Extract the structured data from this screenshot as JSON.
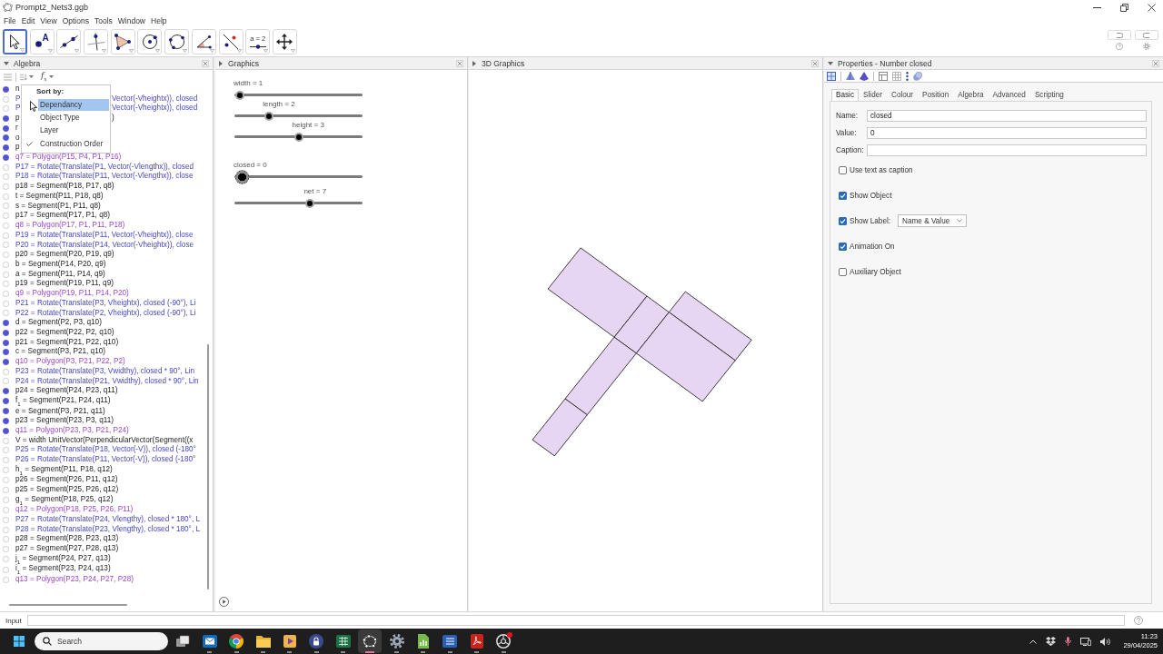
{
  "window": {
    "title": "Prompt2_Nets3.ggb"
  },
  "menu": [
    "File",
    "Edit",
    "View",
    "Options",
    "Tools",
    "Window",
    "Help"
  ],
  "toolbar": {
    "tools": [
      {
        "kind": "move",
        "selected": true
      },
      {
        "kind": "point",
        "text": "A",
        "selected": false
      },
      {
        "kind": "line",
        "selected": false
      },
      {
        "kind": "perpendicular",
        "selected": false
      },
      {
        "kind": "polygon",
        "selected": false
      },
      {
        "kind": "circle",
        "selected": false
      },
      {
        "kind": "conic",
        "selected": false
      },
      {
        "kind": "angle",
        "selected": false
      },
      {
        "kind": "reflect",
        "selected": false
      },
      {
        "kind": "slider",
        "text": "a = 2",
        "selected": false
      },
      {
        "kind": "pan",
        "selected": false
      }
    ]
  },
  "algebra": {
    "title": "Algebra",
    "style_button": "f$_{x}$",
    "sort_menu": {
      "title": "Sort by:",
      "items": [
        {
          "label": "Dependancy",
          "selected": true,
          "checked": false
        },
        {
          "label": "Object Type",
          "selected": false,
          "checked": false
        },
        {
          "label": "Layer",
          "selected": false,
          "checked": false
        },
        {
          "label": "Construction Order",
          "selected": false,
          "checked": true
        }
      ]
    },
    "rows": [
      {
        "text": "n",
        "kind": "other",
        "visible": true
      },
      {
        "text": "P",
        "tail": "Vector(-Vheightx)), closed",
        "kind": "point",
        "visible": false
      },
      {
        "text": "P",
        "tail": "Vector(-Vheightx)), closed",
        "kind": "point",
        "visible": false
      },
      {
        "text": "p",
        "tail": ")",
        "kind": "other",
        "visible": true
      },
      {
        "text": "r",
        "kind": "other",
        "visible": true
      },
      {
        "text": "o",
        "kind": "other",
        "visible": true
      },
      {
        "text": "p",
        "kind": "other",
        "visible": true
      },
      {
        "text": "q7 = Polygon(P15, P4, P1, P16)",
        "kind": "polygon",
        "visible": true
      },
      {
        "text": "P17 = Rotate(Translate(P1, Vector(-Vlengthx)), closed",
        "kind": "point",
        "visible": false
      },
      {
        "text": "P18 = Rotate(Translate(P11, Vector(-Vlengthx)), close",
        "kind": "point",
        "visible": false
      },
      {
        "text": "p18 = Segment(P18, P17, q8)",
        "kind": "other",
        "visible": false
      },
      {
        "text": "t = Segment(P11, P18, q8)",
        "kind": "other",
        "visible": false
      },
      {
        "text": "s = Segment(P1, P11, q8)",
        "kind": "other",
        "visible": false
      },
      {
        "text": "p17 = Segment(P17, P1, q8)",
        "kind": "other",
        "visible": false
      },
      {
        "text": "q8 = Polygon(P17, P1, P11, P18)",
        "kind": "polygon",
        "visible": false
      },
      {
        "text": "P19 = Rotate(Translate(P11, Vector(-Vheightx)), close",
        "kind": "point",
        "visible": false
      },
      {
        "text": "P20 = Rotate(Translate(P14, Vector(-Vheightx)), close",
        "kind": "point",
        "visible": false
      },
      {
        "text": "p20 = Segment(P20, P19, q9)",
        "kind": "other",
        "visible": false
      },
      {
        "text": "b = Segment(P14, P20, q9)",
        "kind": "other",
        "visible": false
      },
      {
        "text": "a = Segment(P11, P14, q9)",
        "kind": "other",
        "visible": false
      },
      {
        "text": "p19 = Segment(P19, P11, q9)",
        "kind": "other",
        "visible": false
      },
      {
        "text": "q9 = Polygon(P19, P11, P14, P20)",
        "kind": "polygon",
        "visible": false
      },
      {
        "text": "P21 = Rotate(Translate(P3, Vheightx), closed (-90°), Li",
        "kind": "point",
        "visible": false
      },
      {
        "text": "P22 = Rotate(Translate(P2, Vheightx), closed (-90°), Li",
        "kind": "point",
        "visible": false
      },
      {
        "text": "d = Segment(P2, P3, q10)",
        "kind": "other",
        "visible": true
      },
      {
        "text": "p22 = Segment(P22, P2, q10)",
        "kind": "other",
        "visible": true
      },
      {
        "text": "p21 = Segment(P21, P22, q10)",
        "kind": "other",
        "visible": true
      },
      {
        "text": "c = Segment(P3, P21, q10)",
        "kind": "other",
        "visible": true
      },
      {
        "text": "q10 = Polygon(P3, P21, P22, P2)",
        "kind": "polygon",
        "visible": true
      },
      {
        "text": "P23 = Rotate(Translate(P3, Vwidthy), closed * 90°, Lin",
        "kind": "point",
        "visible": false
      },
      {
        "text": "P24 = Rotate(Translate(P21, Vwidthy), closed * 90°, Lin",
        "kind": "point",
        "visible": false
      },
      {
        "text": "p24 = Segment(P24, P23, q11)",
        "kind": "other",
        "visible": true
      },
      {
        "text": "f$_{1}$ = Segment(P21, P24, q11)",
        "kind": "other",
        "visible": true
      },
      {
        "text": "e = Segment(P3, P21, q11)",
        "kind": "other",
        "visible": true
      },
      {
        "text": "p23 = Segment(P23, P3, q11)",
        "kind": "other",
        "visible": true
      },
      {
        "text": "q11 = Polygon(P23, P3, P21, P24)",
        "kind": "polygon",
        "visible": true
      },
      {
        "text": "V = width UnitVector(PerpendicularVector(Segment((x",
        "kind": "other",
        "visible": false
      },
      {
        "text": "P25 = Rotate(Translate(P18, Vector(-V)), closed (-180°",
        "kind": "point",
        "visible": false
      },
      {
        "text": "P26 = Rotate(Translate(P11, Vector(-V)), closed (-180°",
        "kind": "point",
        "visible": false
      },
      {
        "text": "h$_{1}$ = Segment(P11, P18, q12)",
        "kind": "other",
        "visible": false
      },
      {
        "text": "p26 = Segment(P26, P11, q12)",
        "kind": "other",
        "visible": false
      },
      {
        "text": "p25 = Segment(P25, P26, q12)",
        "kind": "other",
        "visible": false
      },
      {
        "text": "g$_{1}$ = Segment(P18, P25, q12)",
        "kind": "other",
        "visible": false
      },
      {
        "text": "q12 = Polygon(P18, P25, P26, P11)",
        "kind": "polygon",
        "visible": false
      },
      {
        "text": "P27 = Rotate(Translate(P24, Vlengthy), closed * 180°, L",
        "kind": "point",
        "visible": false
      },
      {
        "text": "P28 = Rotate(Translate(P23, Vlengthy), closed * 180°, L",
        "kind": "point",
        "visible": false
      },
      {
        "text": "p28 = Segment(P28, P23, q13)",
        "kind": "other",
        "visible": false
      },
      {
        "text": "p27 = Segment(P27, P28, q13)",
        "kind": "other",
        "visible": false
      },
      {
        "text": "j$_{1}$ = Segment(P24, P27, q13)",
        "kind": "other",
        "visible": false
      },
      {
        "text": "i$_{1}$ = Segment(P23, P24, q13)",
        "kind": "other",
        "visible": false
      },
      {
        "text": "q13 = Polygon(P23, P24, P27, P28)",
        "kind": "polygon",
        "visible": false
      }
    ]
  },
  "graphics": {
    "title": "Graphics",
    "sliders": [
      {
        "label": "width = 1",
        "level": 0,
        "selected": false
      },
      {
        "label": "length = 2",
        "level": 0.25,
        "selected": false
      },
      {
        "label": "height = 3",
        "level": 0.5,
        "selected": false
      },
      {
        "label": "closed = 0",
        "level": 0,
        "selected": true
      },
      {
        "label": "net = 7",
        "level": 0.6,
        "selected": false
      }
    ]
  },
  "graphics_3d": {
    "title": "3D Graphics"
  },
  "properties": {
    "title": "Properties - Number closed",
    "tabs": [
      {
        "label": "Basic",
        "selected": true
      },
      {
        "label": "Slider",
        "selected": false
      },
      {
        "label": "Colour",
        "selected": false
      },
      {
        "label": "Position",
        "selected": false
      },
      {
        "label": "Algebra",
        "selected": false
      },
      {
        "label": "Advanced",
        "selected": false
      },
      {
        "label": "Scripting",
        "selected": false
      }
    ],
    "fields": [
      {
        "label": "Name:",
        "value": "closed"
      },
      {
        "label": "Value:",
        "value": "0"
      },
      {
        "label": "Caption:"
      }
    ],
    "checkboxes": [
      {
        "label": "Use text as caption",
        "checked": false
      },
      {
        "label": "Show Object",
        "checked": true
      },
      {
        "label": "Show Label:",
        "checked": true,
        "dropdown": "Name & Value"
      },
      {
        "label": "Animation On",
        "checked": true
      },
      {
        "label": "Auxiliary Object",
        "checked": false
      }
    ]
  },
  "input_bar": {
    "label": "Input"
  },
  "taskbar": {
    "search": {
      "placeholder": "Search"
    },
    "apps": [
      {
        "kind": "task-view",
        "selected": false,
        "running": false,
        "notification": false
      },
      {
        "kind": "mail",
        "selected": false,
        "running": true,
        "notification": false
      },
      {
        "kind": "browser",
        "selected": false,
        "running": true,
        "notification": false
      },
      {
        "kind": "folder",
        "selected": false,
        "running": true,
        "notification": false
      },
      {
        "kind": "media",
        "selected": false,
        "running": true,
        "notification": false
      },
      {
        "kind": "lock",
        "selected": false,
        "running": true,
        "notification": false
      },
      {
        "kind": "spreadsheet",
        "selected": false,
        "running": true,
        "notification": false
      },
      {
        "kind": "geometry",
        "selected": true,
        "running": true,
        "notification": false
      },
      {
        "kind": "settings",
        "selected": false,
        "running": true,
        "notification": false
      },
      {
        "kind": "chart-document",
        "selected": false,
        "running": true,
        "notification": false
      },
      {
        "kind": "text-document",
        "selected": false,
        "running": true,
        "notification": false
      },
      {
        "kind": "pdf",
        "selected": false,
        "running": true,
        "notification": false
      },
      {
        "kind": "aperture",
        "selected": false,
        "running": true,
        "notification": true
      }
    ],
    "time": "11:23",
    "date": "29/04/2025"
  }
}
